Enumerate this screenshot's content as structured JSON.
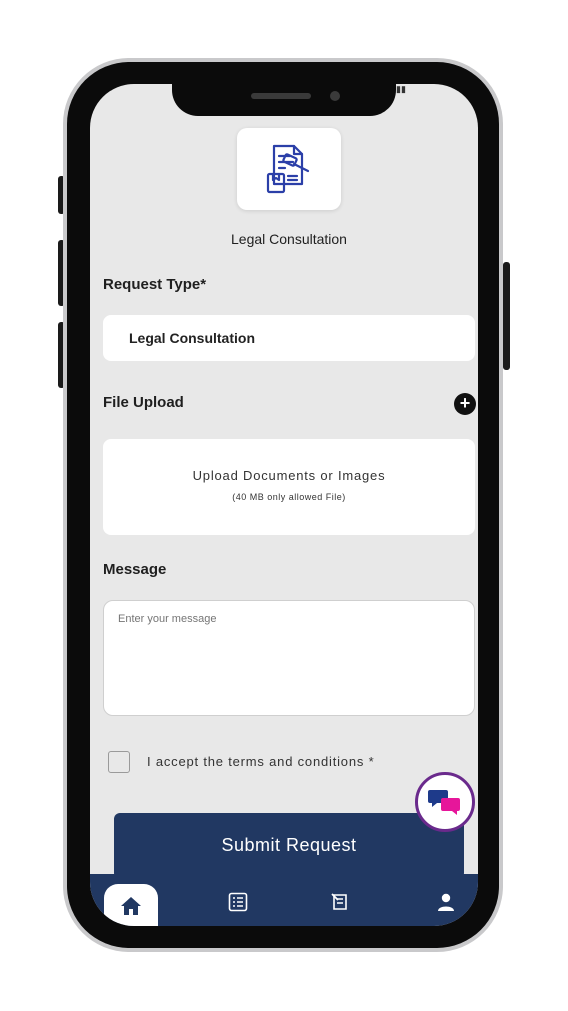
{
  "screen": {
    "service_caption": "Legal Consultation",
    "request_type": {
      "label": "Request Type*",
      "value": "Legal Consultation"
    },
    "file_upload": {
      "label": "File Upload",
      "title": "Upload Documents or Images",
      "subtitle": "(40 MB only allowed File)"
    },
    "message": {
      "label": "Message",
      "placeholder": "Enter your message"
    },
    "terms_label": "I accept the terms and conditions *",
    "submit_label": "Submit Request"
  },
  "bottom_nav": {
    "items": [
      "home-icon",
      "list-icon",
      "document-icon",
      "profile-icon"
    ],
    "active": "home-icon"
  },
  "colors": {
    "primary_navy": "#213862",
    "background": "#e8e8e8",
    "logo_blue": "#2b3fa8",
    "chat_purple": "#6a2a8c",
    "chat_pink": "#e6169a"
  }
}
